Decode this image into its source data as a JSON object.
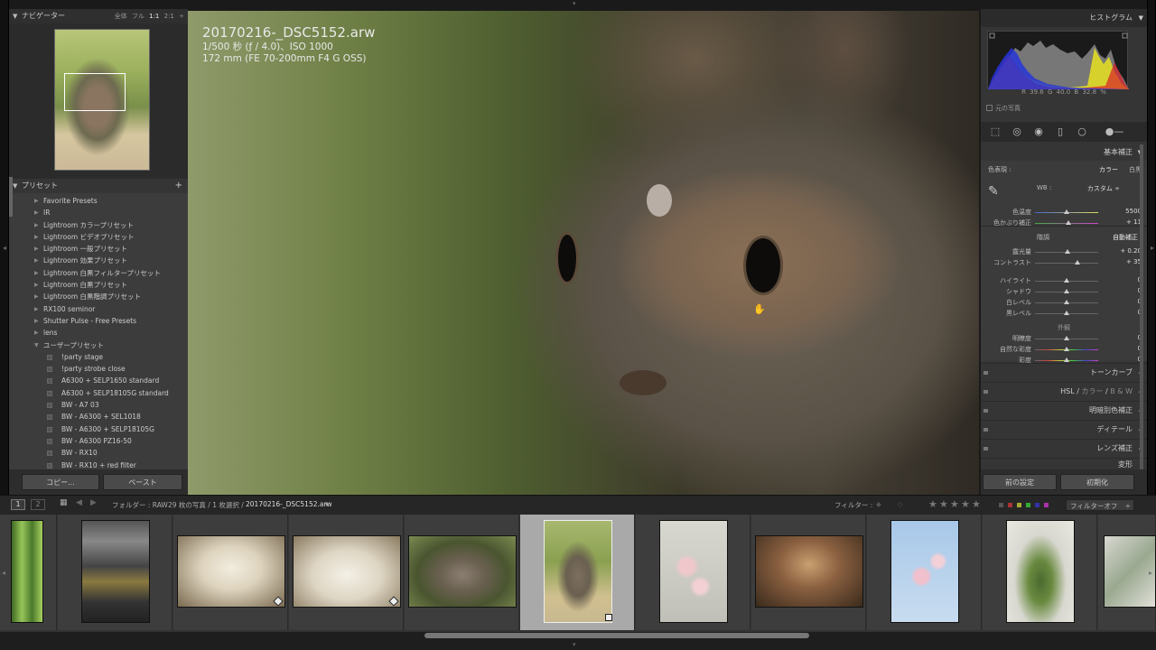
{
  "navigator": {
    "title": "ナビゲーター",
    "zoom_options": [
      "全体",
      "フル",
      "1:1",
      "2:1"
    ]
  },
  "presets": {
    "title": "プリセット",
    "add_label": "+",
    "items": [
      {
        "label": "Favorite Presets",
        "type": "folder"
      },
      {
        "label": "IR",
        "type": "folder"
      },
      {
        "label": "Lightroom カラープリセット",
        "type": "folder"
      },
      {
        "label": "Lightroom ビデオプリセット",
        "type": "folder"
      },
      {
        "label": "Lightroom 一般プリセット",
        "type": "folder"
      },
      {
        "label": "Lightroom 効果プリセット",
        "type": "folder"
      },
      {
        "label": "Lightroom 白黒フィルタープリセット",
        "type": "folder"
      },
      {
        "label": "Lightroom 白黒プリセット",
        "type": "folder"
      },
      {
        "label": "Lightroom 白黒階調プリセット",
        "type": "folder"
      },
      {
        "label": "RX100 seminor",
        "type": "folder"
      },
      {
        "label": "Shutter Pulse - Free Presets",
        "type": "folder"
      },
      {
        "label": "lens",
        "type": "folder"
      },
      {
        "label": "ユーザープリセット",
        "type": "open"
      },
      {
        "label": "!party stage",
        "type": "preset"
      },
      {
        "label": "!party strobe close",
        "type": "preset"
      },
      {
        "label": "A6300 + SELP1650 standard",
        "type": "preset"
      },
      {
        "label": "A6300 + SELP18105G standard",
        "type": "preset"
      },
      {
        "label": "BW - A7 03",
        "type": "preset"
      },
      {
        "label": "BW - A6300 + SEL1018",
        "type": "preset"
      },
      {
        "label": "BW - A6300 + SELP18105G",
        "type": "preset"
      },
      {
        "label": "BW - A6300 PZ16-50",
        "type": "preset"
      },
      {
        "label": "BW - RX10",
        "type": "preset"
      },
      {
        "label": "BW - RX10 + red filter",
        "type": "preset"
      }
    ]
  },
  "left_buttons": {
    "copy": "コピー...",
    "paste": "ペースト"
  },
  "image": {
    "filename": "20170216-_DSC5152.arw",
    "exposure": "1/500 秒 (ƒ / 4.0)、ISO 1000",
    "lens": "172 mm (FE 70-200mm F4 G OSS)"
  },
  "histogram": {
    "title": "ヒストグラム",
    "readout": "R  39.6  G  40.0  B  32.8 %",
    "original_photo": "元の写真"
  },
  "basic": {
    "title": "基本補正",
    "treatment_label": "色表現 :",
    "treatment_color": "カラー",
    "treatment_bw": "白黒",
    "wb_label": "WB :",
    "wb_value": "カスタム ÷",
    "tone_label": "階調",
    "auto_label": "自動補正",
    "presence_label": "外観",
    "sliders": [
      {
        "label": "色温度",
        "value": "5500",
        "pos": 0.5
      },
      {
        "label": "色かぶり補正",
        "value": "+ 11",
        "pos": 0.53
      },
      {
        "label": "露光量",
        "value": "+ 0.20",
        "pos": 0.52
      },
      {
        "label": "コントラスト",
        "value": "+ 35",
        "pos": 0.67
      },
      {
        "label": "ハイライト",
        "value": "0",
        "pos": 0.5
      },
      {
        "label": "シャドウ",
        "value": "0",
        "pos": 0.5
      },
      {
        "label": "白レベル",
        "value": "0",
        "pos": 0.5
      },
      {
        "label": "黒レベル",
        "value": "0",
        "pos": 0.5
      },
      {
        "label": "明瞭度",
        "value": "0",
        "pos": 0.5
      },
      {
        "label": "自然な彩度",
        "value": "0",
        "pos": 0.5
      },
      {
        "label": "彩度",
        "value": "0",
        "pos": 0.5
      }
    ]
  },
  "panels": {
    "tone_curve": "トーンカーブ",
    "hsl": "HSL",
    "hsl_color": "カラー",
    "hsl_bw": "B & W",
    "split_toning": "明暗別色補正",
    "detail": "ディテール",
    "lens_corrections": "レンズ補正",
    "effects": "変形"
  },
  "right_buttons": {
    "previous": "前の設定",
    "reset": "初期化"
  },
  "filmbar": {
    "page1": "1",
    "page2": "2",
    "breadcrumb_prefix": "フォルダー : RAW",
    "breadcrumb_count": "29 枚の写真 / 1 枚選択 /",
    "breadcrumb_file": "20170216-_DSC5152.arw",
    "filter_label": "フィルター :",
    "filter_value": "フィルターオフ"
  },
  "colors": {
    "accent": "#a9a9a9",
    "panel": "#353535",
    "background": "#1a1a1a"
  }
}
